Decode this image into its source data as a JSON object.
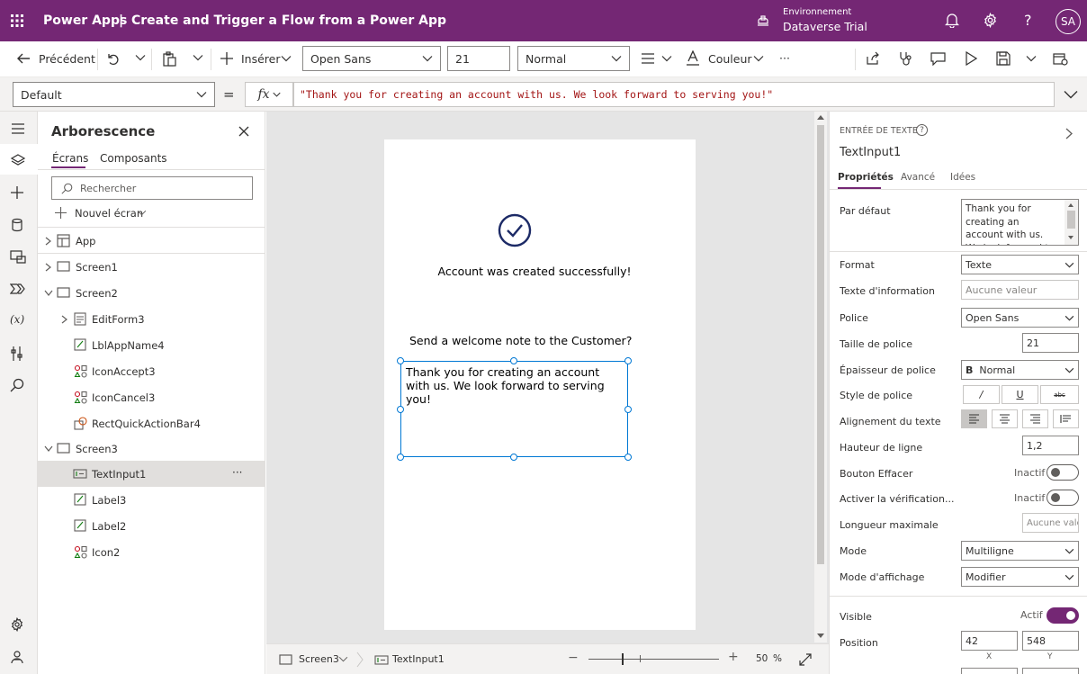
{
  "header": {
    "app_name": "Power Apps",
    "separator": "|",
    "doc_title": "Create and Trigger a Flow from a Power App",
    "env_label": "Environnement",
    "env_name": "Dataverse Trial",
    "avatar": "SA",
    "help": "?"
  },
  "toolbar": {
    "back_label": "Précédent",
    "insert_label": "Insérer",
    "font_value": "Open Sans",
    "size_value": "21",
    "weight_value": "Normal",
    "color_label": "Couleur",
    "more": "···"
  },
  "formula": {
    "property": "Default",
    "equals": "=",
    "fx": "fx",
    "expression": "\"Thank you for creating an account with us. We look forward to serving you!\""
  },
  "tree": {
    "title": "Arborescence",
    "tab_screens": "Écrans",
    "tab_components": "Composants",
    "search_placeholder": "Rechercher",
    "new_screen": "Nouvel écran",
    "items": [
      {
        "label": "App",
        "icon": "app-icon"
      },
      {
        "label": "Screen1",
        "icon": "screen-icon"
      },
      {
        "label": "Screen2",
        "icon": "screen-icon"
      },
      {
        "label": "EditForm3",
        "icon": "form-icon"
      },
      {
        "label": "LblAppName4",
        "icon": "label-icon"
      },
      {
        "label": "IconAccept3",
        "icon": "icons-icon"
      },
      {
        "label": "IconCancel3",
        "icon": "icons-icon"
      },
      {
        "label": "RectQuickActionBar4",
        "icon": "shape-icon"
      },
      {
        "label": "Screen3",
        "icon": "screen-icon"
      },
      {
        "label": "TextInput1",
        "icon": "text-input-icon"
      },
      {
        "label": "Label3",
        "icon": "label-icon"
      },
      {
        "label": "Label2",
        "icon": "label-icon"
      },
      {
        "label": "Icon2",
        "icon": "icons-icon"
      }
    ],
    "more": "···"
  },
  "canvas": {
    "success_text": "Account was created successfully!",
    "prompt_text": "Send a welcome note to the Customer?",
    "input_text": "Thank you for creating an account with us. We look forward to serving you!"
  },
  "statusbar": {
    "screen": "Screen3",
    "control": "TextInput1",
    "zoom_minus": "−",
    "zoom_plus": "+",
    "zoom_value": "50",
    "zoom_unit": "%"
  },
  "props": {
    "header": "ENTRÉE DE TEXTE",
    "control_name": "TextInput1",
    "tab_properties": "Propriétés",
    "tab_advanced": "Avancé",
    "tab_ideas": "Idées",
    "default_label": "Par défaut",
    "default_value": "Thank you for creating an account with us. We look forward to serving you!",
    "format_label": "Format",
    "format_value": "Texte",
    "hint_label": "Texte d'information",
    "hint_value": "Aucune valeur",
    "font_label": "Police",
    "font_value": "Open Sans",
    "size_label": "Taille de police",
    "size_value": "21",
    "weight_label": "Épaisseur de police",
    "weight_prefix": "B",
    "weight_value": "Normal",
    "style_label": "Style de police",
    "style_italic": "/",
    "style_underline": "U",
    "style_strike": "abc",
    "align_label": "Alignement du texte",
    "lineheight_label": "Hauteur de ligne",
    "lineheight_value": "1,2",
    "clear_label": "Bouton Effacer",
    "clear_state": "Inactif",
    "spell_label": "Activer la vérification...",
    "spell_state": "Inactif",
    "maxlen_label": "Longueur maximale",
    "maxlen_value": "Aucune vale",
    "mode_label": "Mode",
    "mode_value": "Multiligne",
    "display_label": "Mode d'affichage",
    "display_value": "Modifier",
    "visible_label": "Visible",
    "visible_state": "Actif",
    "position_label": "Position",
    "pos_x": "42",
    "pos_y": "548",
    "x_label": "X",
    "y_label": "Y"
  },
  "colors": {
    "brand": "#742774",
    "accent": "#0078d4",
    "check": "#1c2a66"
  }
}
